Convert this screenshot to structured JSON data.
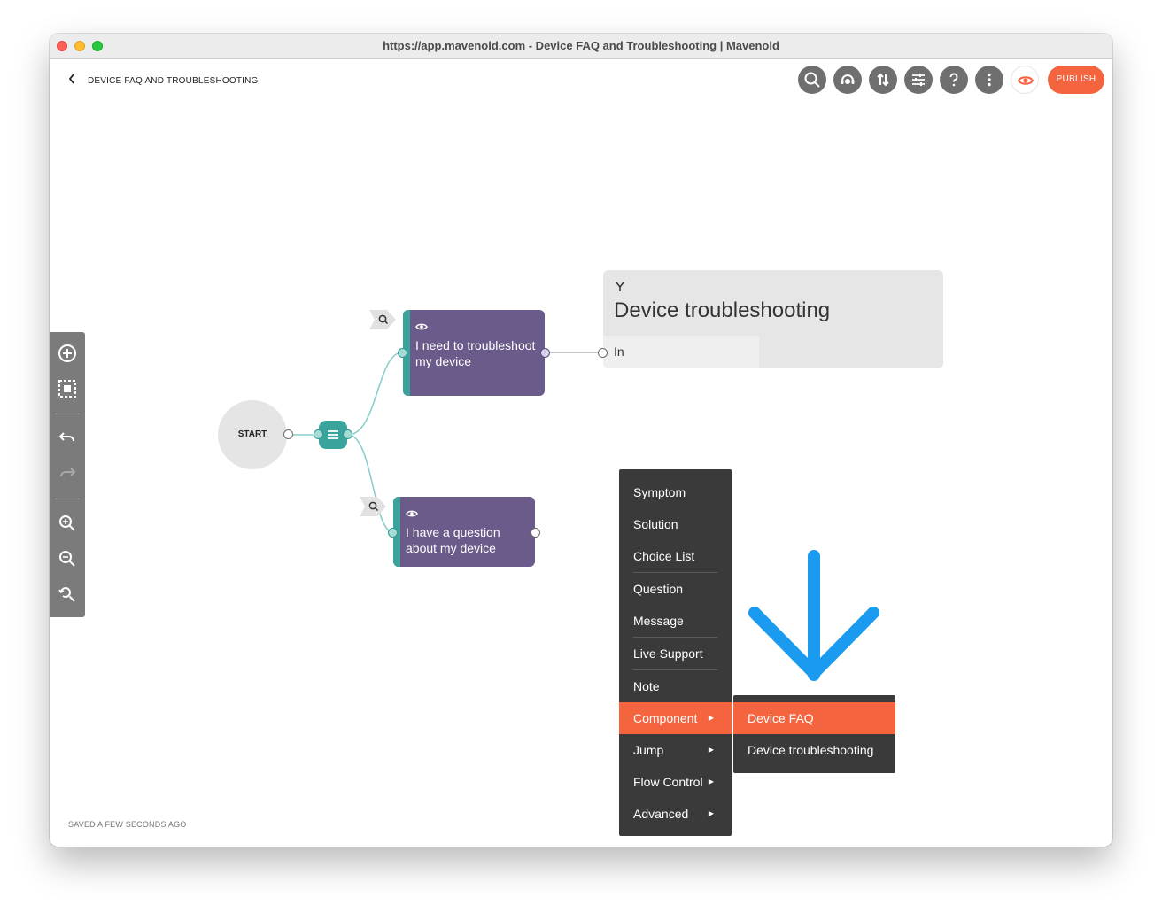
{
  "window": {
    "title": "https://app.mavenoid.com - Device FAQ and Troubleshooting | Mavenoid"
  },
  "header": {
    "back_icon": "chevron-left-icon",
    "breadcrumb": "DEVICE FAQ AND TROUBLESHOOTING",
    "toolbar_icons": [
      "search-icon",
      "support-agent-icon",
      "sort-arrows-icon",
      "sliders-icon",
      "help-icon",
      "more-vertical-icon",
      "eye-icon"
    ],
    "publish_label": "PUBLISH"
  },
  "tools": [
    "add-circle-icon",
    "select-area-icon",
    "undo-icon",
    "redo-icon",
    "zoom-in-icon",
    "zoom-out-icon",
    "zoom-reset-icon"
  ],
  "flow": {
    "start_label": "START",
    "nodes": [
      {
        "text": "I need to troubleshoot my device",
        "icon": "eye-icon"
      },
      {
        "text": "I have a question about my device",
        "icon": "eye-icon"
      }
    ],
    "component": {
      "icon": "fork-icon",
      "title": "Device troubleshooting",
      "input_label": "In"
    }
  },
  "context_menu": {
    "items": [
      {
        "label": "Symptom",
        "submenu": false
      },
      {
        "label": "Solution",
        "submenu": false
      },
      {
        "label": "Choice List",
        "submenu": false
      },
      {
        "label": "Question",
        "submenu": false
      },
      {
        "label": "Message",
        "submenu": false
      },
      {
        "label": "Live Support",
        "submenu": false
      },
      {
        "label": "Note",
        "submenu": false
      },
      {
        "label": "Component",
        "submenu": true,
        "active": true
      },
      {
        "label": "Jump",
        "submenu": true
      },
      {
        "label": "Flow Control",
        "submenu": true
      },
      {
        "label": "Advanced",
        "submenu": true
      }
    ],
    "submenu_items": [
      {
        "label": "Device FAQ",
        "active": true
      },
      {
        "label": "Device troubleshooting"
      }
    ]
  },
  "annotation_arrow": {
    "icon": "arrow-down-icon",
    "color": "#1a9bf0"
  },
  "colors": {
    "accent": "#f4643f",
    "node": "#6b5b8a",
    "teal": "#3aa39b",
    "menu": "#3a3a3a"
  },
  "status": {
    "saved": "SAVED A FEW SECONDS AGO"
  }
}
